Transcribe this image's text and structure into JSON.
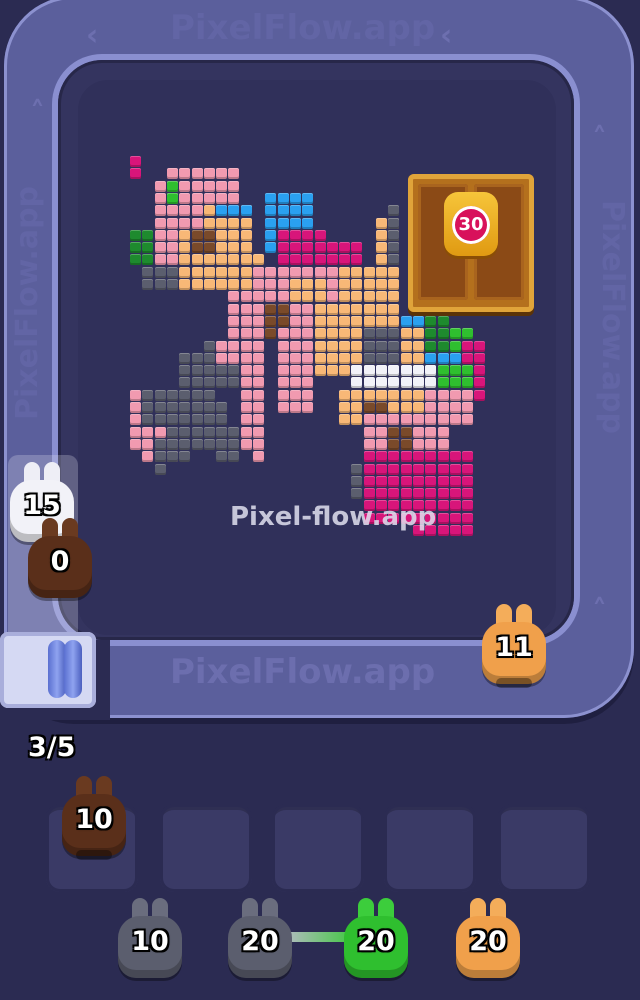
{
  "watermarks": {
    "top": "PixelFlow.app",
    "center": "Pixel-flow.app",
    "bottom": "PixelFlow.app",
    "right": "PixelFlow.app",
    "left": "PixelFlow.app"
  },
  "chest": {
    "lock_count": "30"
  },
  "conveyor": {
    "capacity": "3/5",
    "top_rabbit_white": "15",
    "top_rabbit_brown": "0",
    "right_rabbit_orange": "11"
  },
  "tray": {
    "rabbit_in_slot_1": "10"
  },
  "queue": [
    {
      "count": "10",
      "color": "gray"
    },
    {
      "count": "20",
      "color": "gray"
    },
    {
      "count": "20",
      "color": "green"
    },
    {
      "count": "20",
      "color": "orange"
    }
  ],
  "colors": {
    "brown": "#5a2f1a",
    "gray": "#5b5e6e",
    "green": "#2fbf2f",
    "orange": "#f0a04b",
    "white": "#f2f2f8",
    "pink": "#f19ab0",
    "magenta": "#d8157a",
    "peach": "#f8b877",
    "blue": "#2aa0f0",
    "dkgreen": "#1e8a2e"
  }
}
